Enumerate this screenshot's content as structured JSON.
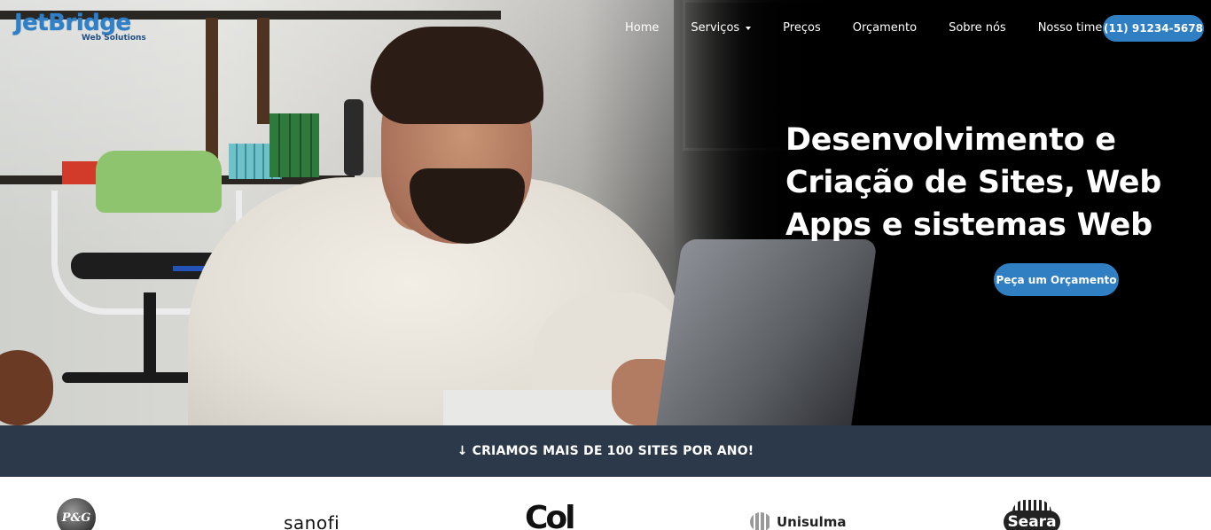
{
  "brand": {
    "name": "JetBridge",
    "tagline": "Web Solutions",
    "accent": "#2f7fc2"
  },
  "nav": {
    "items": [
      {
        "label": "Home"
      },
      {
        "label": "Serviços"
      },
      {
        "label": "Preços"
      },
      {
        "label": "Orçamento"
      },
      {
        "label": "Sobre nós"
      },
      {
        "label": "Nosso time"
      }
    ],
    "phone": "(11) 91234-5678"
  },
  "hero": {
    "title": "Desenvolvimento e Criação de Sites, Web Apps e sistemas Web",
    "cta": "Peça um Orçamento"
  },
  "banner": {
    "text": "↓ CRIAMOS MAIS DE 100 SITES POR ANO!",
    "bg": "#2b394b"
  },
  "clients": {
    "pg": "P&G",
    "sanofi": "sanofi",
    "col": "Col",
    "unisulma": "Unisulma",
    "seara": "Seara"
  }
}
